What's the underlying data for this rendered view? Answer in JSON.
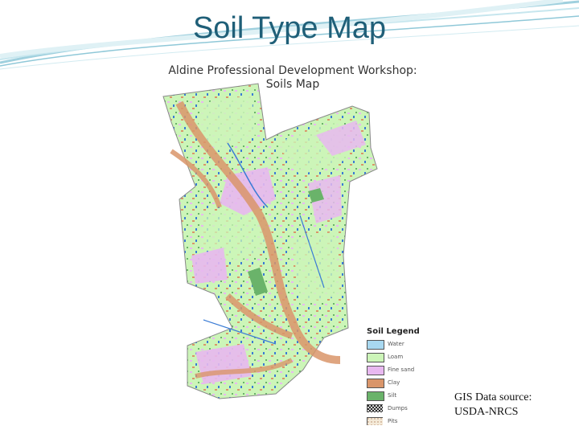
{
  "slide": {
    "title": "Soil Type Map",
    "source_line1": "GIS Data source:",
    "source_line2": "USDA-NRCS"
  },
  "map": {
    "title_line1": "Aldine Professional Development Workshop:",
    "title_line2": "Soils Map",
    "legend": {
      "title": "Soil Legend",
      "items": [
        {
          "label": "Water",
          "color": "#a8d8f0"
        },
        {
          "label": "Loam",
          "color": "#ccf5b8"
        },
        {
          "label": "Fine sand",
          "color": "#e8b8f0"
        },
        {
          "label": "Clay",
          "color": "#d9956a"
        },
        {
          "label": "Silt",
          "color": "#6ab36a"
        },
        {
          "label": "Dumps",
          "color": "#ffffff"
        },
        {
          "label": "Pits",
          "color": "#f4ead8"
        }
      ]
    }
  },
  "colors": {
    "title": "#1f5f78",
    "swoosh": "#8fc8d8"
  }
}
